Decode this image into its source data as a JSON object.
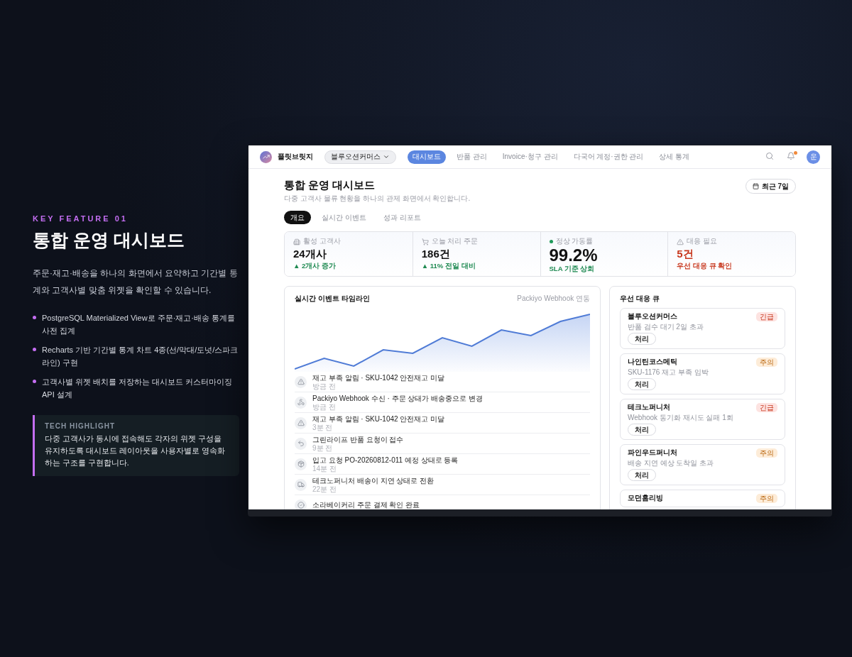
{
  "feature": {
    "eyebrow": "KEY FEATURE 01",
    "title": "통합 운영 대시보드",
    "description": "주문·재고·배송을 하나의 화면에서 요약하고 기간별 통계와 고객사별 맞춤 위젯을 확인할 수 있습니다.",
    "bullets": [
      "PostgreSQL Materialized View로 주문·재고·배송 통계를 사전 집계",
      "Recharts 기반 기간별 통계 차트 4종(선/막대/도넛/스파크라인) 구현",
      "고객사별 위젯 배치를 저장하는 대시보드 커스터마이징 API 설계"
    ],
    "highlight": {
      "label": "TECH HIGHLIGHT",
      "text": "다중 고객사가 동시에 접속해도 각자의 위젯 구성을 유지하도록 대시보드 레이아웃을 사용자별로 영속화하는 구조를 구현합니다."
    }
  },
  "app": {
    "brand": "플릿브릿지",
    "tenant": "블루오션커머스",
    "nav": [
      {
        "label": "대시보드",
        "selected": true
      },
      {
        "label": "반품 관리",
        "selected": false
      },
      {
        "label": "Invoice·청구 관리",
        "selected": false
      },
      {
        "label": "다국어 계정·권한 관리",
        "selected": false
      },
      {
        "label": "상세 통계",
        "selected": false
      }
    ],
    "has_notification": true,
    "avatar": "운"
  },
  "page": {
    "title": "통합 운영 대시보드",
    "subtitle": "다중 고객사 물류 현황을 하나의 관제 화면에서 확인합니다.",
    "date_range": "최근 7일",
    "tabs": [
      {
        "label": "개요",
        "selected": true
      },
      {
        "label": "실시간 이벤트",
        "selected": false
      },
      {
        "label": "성과 리포트",
        "selected": false
      }
    ]
  },
  "kpis": [
    {
      "kind": "customers",
      "label": "활성 고객사",
      "value": "24개사",
      "note": "▲ 2개사 증가",
      "alert": false
    },
    {
      "kind": "orders",
      "label": "오늘 처리 주문",
      "value": "186건",
      "note": "▲ 11% 전일 대비",
      "alert": false
    },
    {
      "kind": "uptime",
      "label": "정상 가동률",
      "value": "99.2%",
      "note": "SLA 기준 상회",
      "alert": false
    },
    {
      "kind": "alerts",
      "label": "대응 필요",
      "value": "5건",
      "note": "우선 대응 큐 확인",
      "alert": true
    }
  ],
  "timeline": {
    "title": "실시간 이벤트 타임라인",
    "source": "Packiyo Webhook 연동",
    "events": [
      {
        "kind": "warning",
        "title": "재고 부족 알림 · SKU-1042 안전재고 미달",
        "time": "방금 전"
      },
      {
        "kind": "webhook",
        "title": "Packiyo Webhook 수신 · 주문 상태가 배송중으로 변경",
        "time": "방금 전"
      },
      {
        "kind": "warning",
        "title": "재고 부족 알림 · SKU-1042 안전재고 미달",
        "time": "3분 전"
      },
      {
        "kind": "return",
        "title": "그린라이프 반품 요청이 접수",
        "time": "9분 전"
      },
      {
        "kind": "inbound",
        "title": "입고 요청 PO-20260812-011 예정 상태로 등록",
        "time": "14분 전"
      },
      {
        "kind": "delivery",
        "title": "테크노퍼니처 배송이 지연 상태로 전환",
        "time": "22분 전"
      },
      {
        "kind": "payment",
        "title": "소라베이커리 주문 결제 확인 완료"
      }
    ]
  },
  "queue": {
    "title": "우선 대응 큐",
    "items": [
      {
        "name": "블루오션커머스",
        "description": "반품 검수 대기 2일 초과",
        "priority": {
          "kind": "urgent",
          "label": "긴급"
        },
        "action": "처리"
      },
      {
        "name": "나인틴코스메틱",
        "description": "SKU-1176 재고 부족 임박",
        "priority": {
          "kind": "caution",
          "label": "주의"
        },
        "action": "처리"
      },
      {
        "name": "테크노퍼니처",
        "description": "Webhook 동기화 재시도 실패 1회",
        "priority": {
          "kind": "urgent",
          "label": "긴급"
        },
        "action": "처리"
      },
      {
        "name": "파인우드퍼니처",
        "description": "배송 지연 예상 도착일 초과",
        "priority": {
          "kind": "caution",
          "label": "주의"
        },
        "action": "처리"
      },
      {
        "name": "모던홈리빙",
        "priority": {
          "kind": "caution",
          "label": "주의"
        }
      }
    ]
  }
}
